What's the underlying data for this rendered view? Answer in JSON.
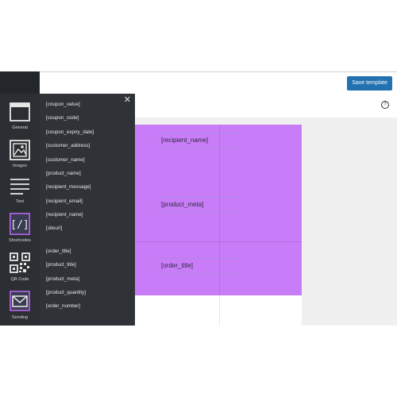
{
  "toolbar": {
    "save_label": "Save template",
    "help_icon": "help-circle-icon"
  },
  "sidebar": {
    "items": [
      {
        "label": "General",
        "icon": "layout-icon"
      },
      {
        "label": "Images",
        "icon": "image-icon"
      },
      {
        "label": "Text",
        "icon": "text-lines-icon"
      },
      {
        "label": "Shortcodes",
        "icon": "shortcode-brackets-icon"
      },
      {
        "label": "QR Code",
        "icon": "qr-code-icon"
      },
      {
        "label": "Sending",
        "icon": "envelope-icon"
      }
    ]
  },
  "panel": {
    "close_icon": "close-icon",
    "group1": [
      "[coupon_value]",
      "[coupon_code]",
      "[coupon_expiry_date]",
      "[customer_address]",
      "[customer_name]",
      "[product_name]",
      "[recipient_message]",
      "[recipient_email]",
      "[recipient_name]",
      "[siteurl]"
    ],
    "group2": [
      "[order_title]",
      "[product_title]",
      "[product_meta]",
      "[product_quantity]",
      "[order_number]"
    ]
  },
  "canvas": {
    "fields": [
      "[recipient_name]",
      "[product_meta]",
      "[order_title]"
    ],
    "background_color": "#c87cf7"
  }
}
